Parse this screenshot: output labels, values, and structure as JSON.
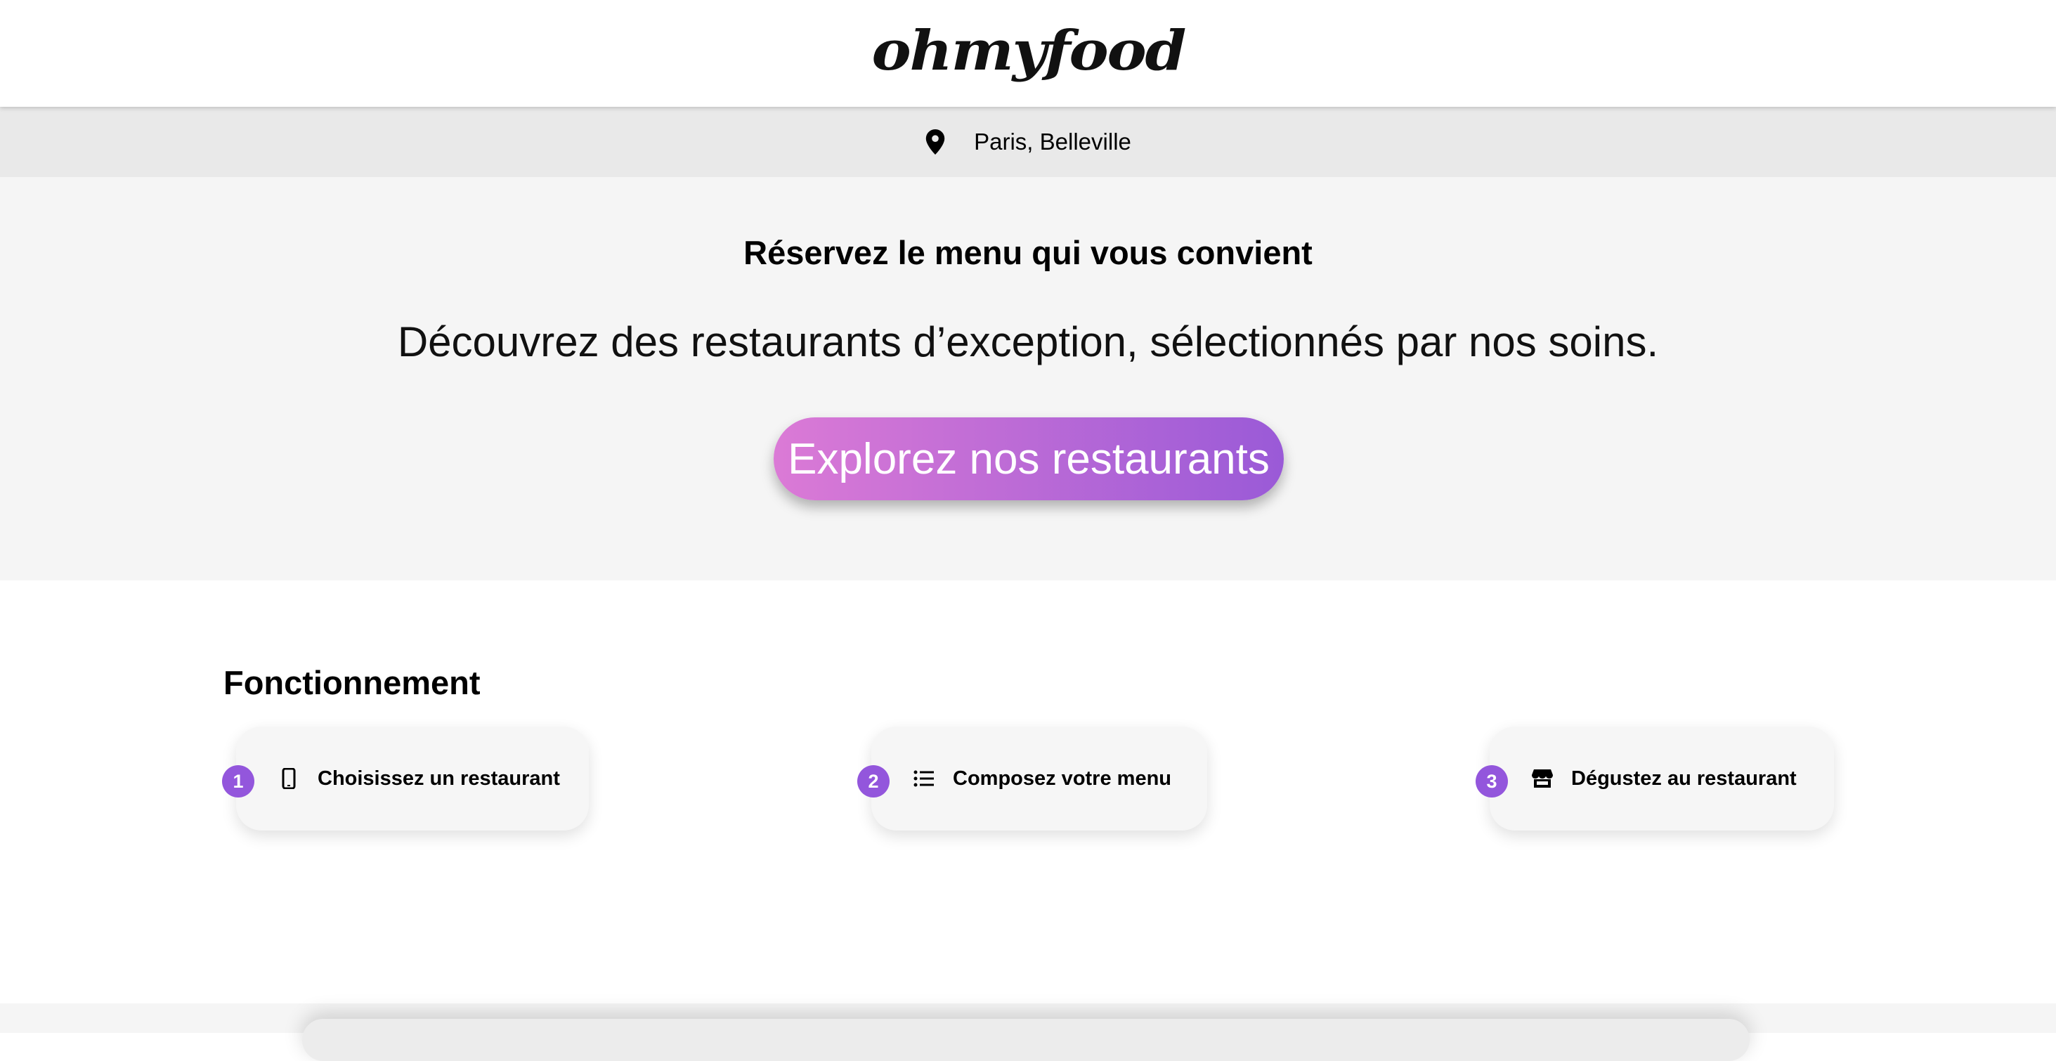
{
  "header": {
    "logo": "ohmyfood"
  },
  "location": {
    "icon": "location-pin-icon",
    "text": "Paris, Belleville"
  },
  "hero": {
    "title": "Réservez le menu qui vous convient",
    "subtitle": "Découvrez des restaurants d’exception, sélectionnés par nos soins.",
    "button_label": "Explorez nos restaurants",
    "button_gradient": [
      "#db7ad6",
      "#9a5ad7"
    ]
  },
  "how_it_works": {
    "title": "Fonctionnement",
    "steps": [
      {
        "number": "1",
        "icon": "smartphone-icon",
        "label": "Choisissez un restaurant"
      },
      {
        "number": "2",
        "icon": "list-icon",
        "label": "Composez votre menu"
      },
      {
        "number": "3",
        "icon": "store-icon",
        "label": "Dégustez au restaurant"
      }
    ]
  },
  "colors": {
    "accent": "#9356dc",
    "hero_background": "#f5f5f5",
    "location_background": "#e9e9e9"
  }
}
